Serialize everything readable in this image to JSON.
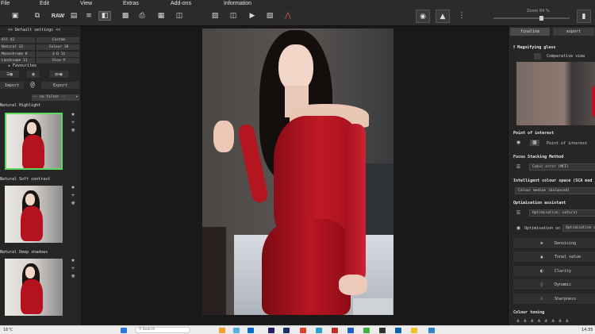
{
  "menu": [
    "File",
    "Edit",
    "View",
    "Extras",
    "Add-ons",
    "Information"
  ],
  "toolbar": {
    "raw_label": "RAW"
  },
  "zoom": {
    "label": "Zoom 64  %",
    "level": 0.64
  },
  "left_panel": {
    "title": ">> Default settings <<",
    "filters": [
      {
        "label": "All  42"
      },
      {
        "label": "Custom"
      },
      {
        "label": "Natural  12"
      },
      {
        "label": "Colour  10"
      },
      {
        "label": "Monochrome  8"
      },
      {
        "label": "3-D  11"
      },
      {
        "label": "Landscape  11"
      },
      {
        "label": "Glow  9"
      }
    ],
    "favourites": "Favourites",
    "import": "Import",
    "export": "Export",
    "filter_select": "-- no filter --",
    "presets": [
      {
        "title": "Natural Highlight"
      },
      {
        "title": "Natural Soft contrast"
      },
      {
        "title": "Natural Deep shadows"
      }
    ]
  },
  "right_panel": {
    "tabs": {
      "finalise": "finalise",
      "export": "export"
    },
    "magnifying_glass": "Magnifying glass",
    "comparative_view": "Comparative view",
    "point_of_interest_heading": "Point of interest",
    "point_of_interest_btn": "Point of interest",
    "focus_stacking_heading": "Focus Stacking Method",
    "focus_stacking_value": "Cubic error (MCE)",
    "intelligent_colour_heading": "Intelligent colour space (SCA mod",
    "intelligent_colour_value": "Colour median (balanced)",
    "optimisation_heading": "Optimisation assistant",
    "optimisation_value": "Optimisation: natural",
    "optimisation_on": "Optimisation on",
    "optimisation_on_value": "Optimisation o",
    "tools": [
      "Denoising",
      "Tonal value",
      "Clarity",
      "Dynamic",
      "Sharpness"
    ],
    "colour_toning": "Colour toning"
  },
  "taskbar": {
    "weather": "16°C",
    "search_placeholder": "Search",
    "clock": "14:35"
  }
}
